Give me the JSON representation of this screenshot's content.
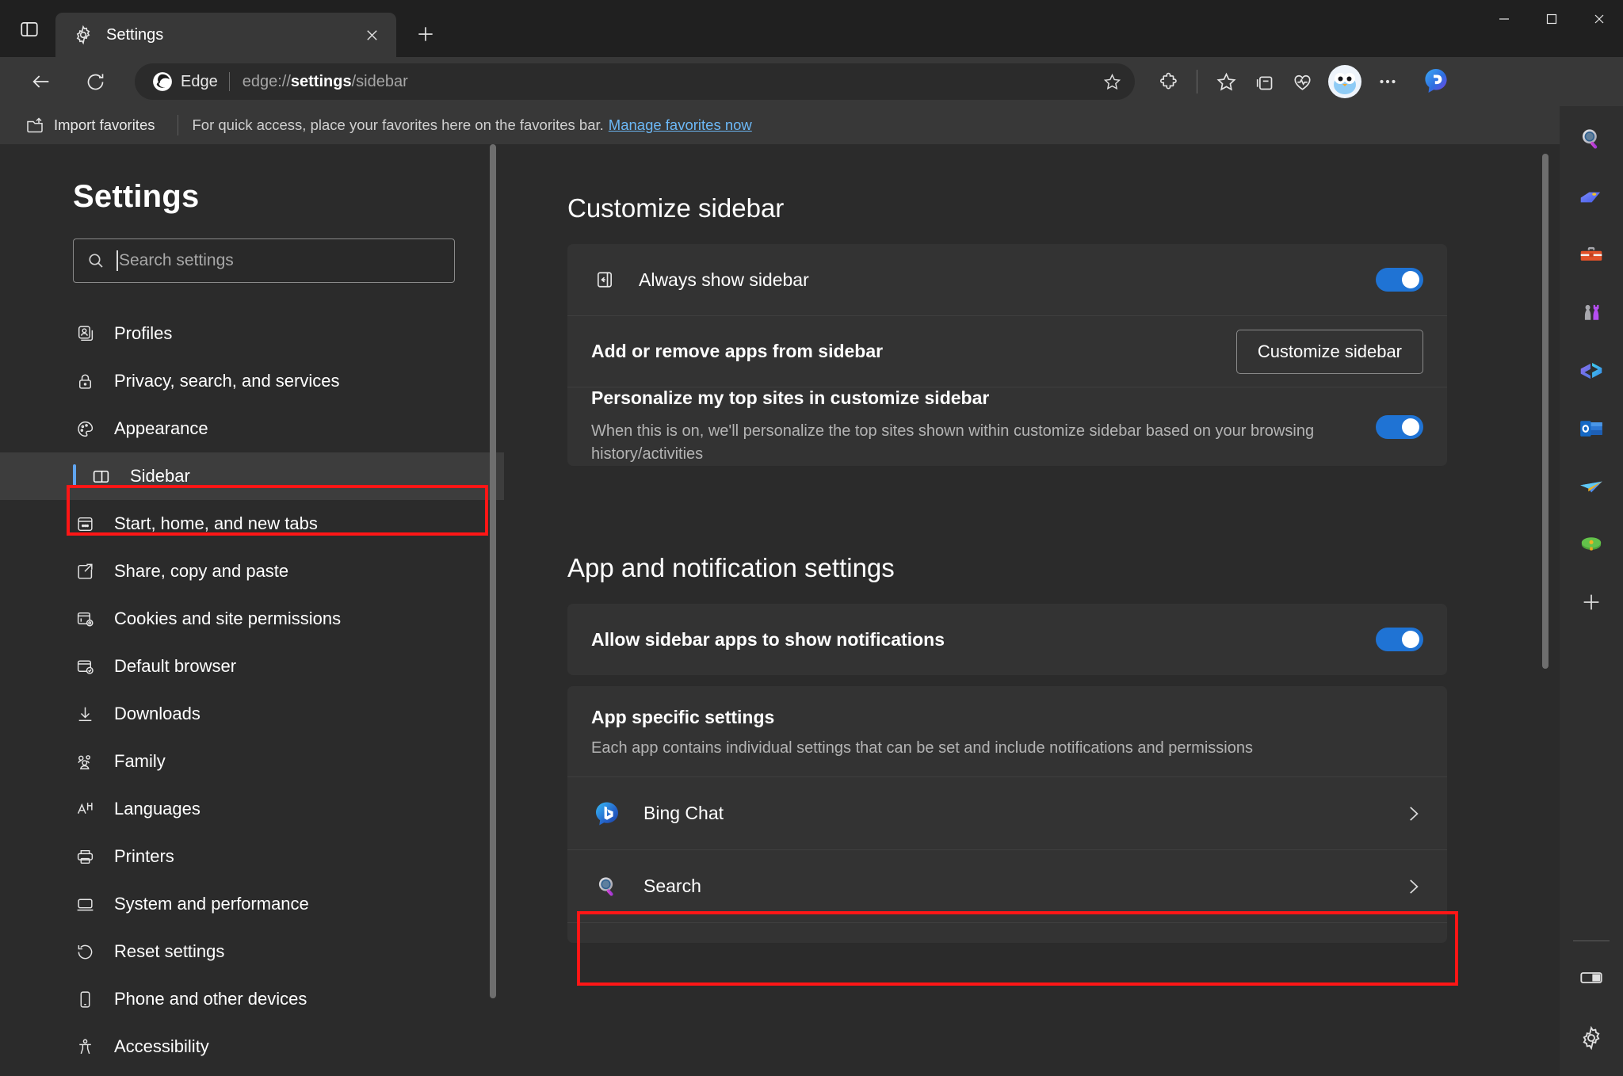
{
  "window": {
    "tab_actions_icon": "tab-actions-icon",
    "minimize_label": "Minimize",
    "maximize_label": "Maximize",
    "close_label": "Close"
  },
  "tabs": [
    {
      "title": "Settings",
      "favicon": "gear-icon",
      "close_label": "Close tab"
    }
  ],
  "newtab_label": "New tab",
  "toolbar": {
    "back_label": "Back",
    "reload_label": "Refresh",
    "brand": "Edge",
    "url_prefix": "edge://",
    "url_bold": "settings",
    "url_suffix": "/sidebar",
    "favorite_label": "Add this page to favorites",
    "extensions_label": "Extensions",
    "favorites_label": "Favorites",
    "collections_label": "Collections",
    "browser_essentials_label": "Browser essentials",
    "profile_label": "Profile",
    "settings_more_label": "Settings and more",
    "copilot_label": "Copilot"
  },
  "favorites_bar": {
    "import_label": "Import favorites",
    "message": "For quick access, place your favorites here on the favorites bar.",
    "link": "Manage favorites now"
  },
  "settings": {
    "title": "Settings",
    "search": {
      "placeholder": "Search settings",
      "value": ""
    },
    "nav_items": [
      {
        "label": "Profiles",
        "icon": "profiles-icon",
        "selected": false
      },
      {
        "label": "Privacy, search, and services",
        "icon": "lock-icon",
        "selected": false
      },
      {
        "label": "Appearance",
        "icon": "palette-icon",
        "selected": false
      },
      {
        "label": "Sidebar",
        "icon": "sidebar-icon",
        "selected": true
      },
      {
        "label": "Start, home, and new tabs",
        "icon": "start-home-icon",
        "selected": false
      },
      {
        "label": "Share, copy and paste",
        "icon": "share-icon",
        "selected": false
      },
      {
        "label": "Cookies and site permissions",
        "icon": "cookies-icon",
        "selected": false
      },
      {
        "label": "Default browser",
        "icon": "default-browser-icon",
        "selected": false
      },
      {
        "label": "Downloads",
        "icon": "download-icon",
        "selected": false
      },
      {
        "label": "Family",
        "icon": "family-icon",
        "selected": false
      },
      {
        "label": "Languages",
        "icon": "languages-icon",
        "selected": false
      },
      {
        "label": "Printers",
        "icon": "printer-icon",
        "selected": false
      },
      {
        "label": "System and performance",
        "icon": "laptop-icon",
        "selected": false
      },
      {
        "label": "Reset settings",
        "icon": "reset-icon",
        "selected": false
      },
      {
        "label": "Phone and other devices",
        "icon": "phone-icon",
        "selected": false
      },
      {
        "label": "Accessibility",
        "icon": "accessibility-icon",
        "selected": false
      }
    ]
  },
  "main": {
    "section1_heading": "Customize sidebar",
    "always_show": {
      "label": "Always show sidebar",
      "icon": "show-sidebar-icon",
      "toggle_on": true
    },
    "add_remove": {
      "label": "Add or remove apps from sidebar",
      "button": "Customize sidebar"
    },
    "personalize": {
      "label": "Personalize my top sites in customize sidebar",
      "description": "When this is on, we'll personalize the top sites shown within customize sidebar based on your browsing history/activities",
      "toggle_on": true
    },
    "section2_heading": "App and notification settings",
    "allow_notifications": {
      "label": "Allow sidebar apps to show notifications",
      "toggle_on": true
    },
    "app_specific": {
      "title": "App specific settings",
      "description": "Each app contains individual settings that can be set and include notifications and permissions",
      "apps": [
        {
          "label": "Bing Chat",
          "icon": "bing-chat-icon",
          "chevron": "chevron-right-icon"
        },
        {
          "label": "Search",
          "icon": "search-magnifier-icon",
          "chevron": "chevron-right-icon"
        }
      ]
    }
  },
  "edge_sidebar": {
    "items": [
      {
        "name": "search-icon",
        "label": "Search"
      },
      {
        "name": "shopping-tag-icon",
        "label": "Shopping"
      },
      {
        "name": "tools-icon",
        "label": "Tools"
      },
      {
        "name": "games-icon",
        "label": "Games"
      },
      {
        "name": "office-icon",
        "label": "Microsoft 365"
      },
      {
        "name": "outlook-icon",
        "label": "Outlook"
      },
      {
        "name": "drop-icon",
        "label": "Drop"
      },
      {
        "name": "gaming-icon",
        "label": "Gaming"
      },
      {
        "name": "plus-icon",
        "label": "Customize"
      }
    ],
    "bottom_items": [
      {
        "name": "split-screen-icon",
        "label": "Split screen"
      },
      {
        "name": "settings-gear-icon",
        "label": "Sidebar settings"
      }
    ]
  },
  "colors": {
    "accent_blue": "#1f73d4",
    "annotation_red": "#ff1616",
    "selected_indicator": "#60a5f0",
    "link_blue": "#6cb8f6"
  }
}
